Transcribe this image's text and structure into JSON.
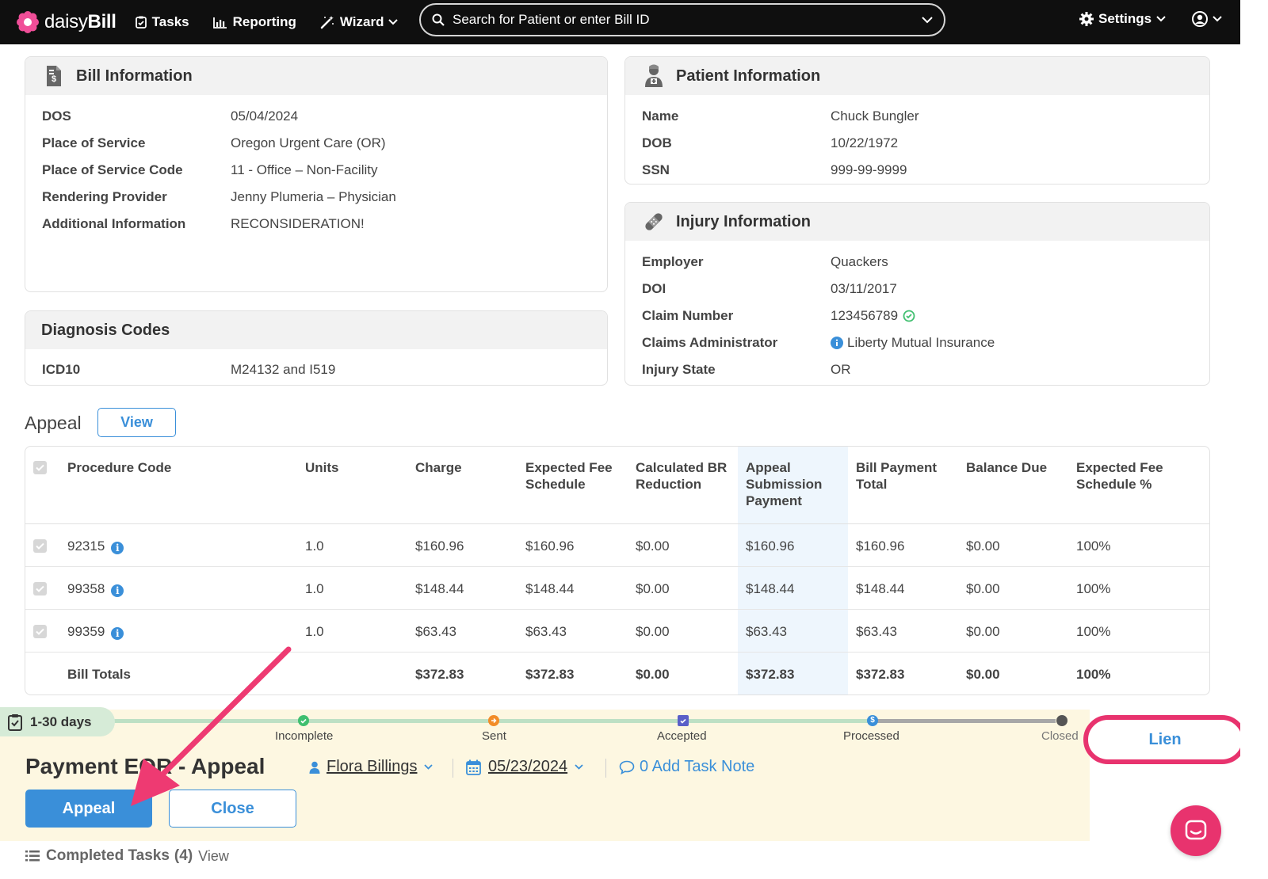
{
  "app": {
    "logo_prefix": "daisy",
    "logo_suffix": "Bill"
  },
  "nav": {
    "tasks": "Tasks",
    "reporting": "Reporting",
    "wizard": "Wizard",
    "settings": "Settings",
    "search_placeholder": "Search for Patient or enter Bill ID"
  },
  "bill_info": {
    "title": "Bill Information",
    "rows": [
      {
        "label": "DOS",
        "value": "05/04/2024"
      },
      {
        "label": "Place of Service",
        "value": "Oregon Urgent Care (OR)"
      },
      {
        "label": "Place of Service Code",
        "value": "11 - Office – Non-Facility"
      },
      {
        "label": "Rendering Provider",
        "value": "Jenny Plumeria – Physician"
      },
      {
        "label": "Additional Information",
        "value": "RECONSIDERATION!"
      }
    ]
  },
  "diagnosis": {
    "title": "Diagnosis Codes",
    "label": "ICD10",
    "value": "M24132 and I519"
  },
  "patient_info": {
    "title": "Patient Information",
    "rows": [
      {
        "label": "Name",
        "value": "Chuck Bungler"
      },
      {
        "label": "DOB",
        "value": "10/22/1972"
      },
      {
        "label": "SSN",
        "value": "999-99-9999"
      }
    ]
  },
  "injury_info": {
    "title": "Injury Information",
    "rows": [
      {
        "label": "Employer",
        "value": "Quackers"
      },
      {
        "label": "DOI",
        "value": "03/11/2017"
      },
      {
        "label": "Claim Number",
        "value": "123456789"
      },
      {
        "label": "Claims Administrator",
        "value": "Liberty Mutual Insurance"
      },
      {
        "label": "Injury State",
        "value": "OR"
      }
    ]
  },
  "appeal": {
    "title": "Appeal",
    "view_label": "View"
  },
  "table": {
    "headers": [
      "Procedure Code",
      "Units",
      "Charge",
      "Expected Fee Schedule",
      "Calculated BR Reduction",
      "Appeal Submission Payment",
      "Bill Payment Total",
      "Balance Due",
      "Expected Fee Schedule %"
    ],
    "rows": [
      [
        "92315",
        "1.0",
        "$160.96",
        "$160.96",
        "$0.00",
        "$160.96",
        "$160.96",
        "$0.00",
        "100%"
      ],
      [
        "99358",
        "1.0",
        "$148.44",
        "$148.44",
        "$0.00",
        "$148.44",
        "$148.44",
        "$0.00",
        "100%"
      ],
      [
        "99359",
        "1.0",
        "$63.43",
        "$63.43",
        "$0.00",
        "$63.43",
        "$63.43",
        "$0.00",
        "100%"
      ]
    ],
    "totals": [
      "Bill Totals",
      "",
      "$372.83",
      "$372.83",
      "$0.00",
      "$372.83",
      "$372.83",
      "$0.00",
      "100%"
    ]
  },
  "task": {
    "age_badge": "1-30 days",
    "stages": [
      "Incomplete",
      "Sent",
      "Accepted",
      "Processed",
      "Closed"
    ],
    "title": "Payment EOR - Appeal",
    "assignee": "Flora Billings",
    "due_date": "05/23/2024",
    "note_label": "0 Add Task Note",
    "appeal_button": "Appeal",
    "close_button": "Close",
    "lien_button": "Lien",
    "completed_label": "Completed Tasks",
    "completed_count": "(4)",
    "completed_view": "View"
  },
  "colors": {
    "accent": "#3a8fd9",
    "highlight": "#e8336e",
    "task_bg": "#fdf7e1",
    "topbar": "#0f0f0f"
  }
}
